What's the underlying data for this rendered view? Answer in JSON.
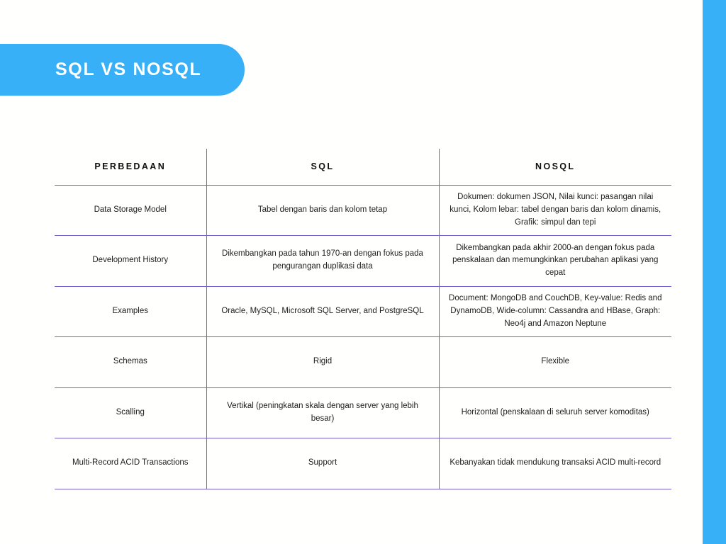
{
  "slide": {
    "title": "SQL VS NOSQL",
    "background_color": "#fffffd",
    "accent_color": "#38b0f7",
    "table_line_color": "#6f62cf"
  },
  "table": {
    "headers": [
      "PERBEDAAN",
      "SQL",
      "NOSQL"
    ],
    "rows": [
      {
        "label": "Data Storage Model",
        "sql": "Tabel dengan baris dan kolom tetap",
        "nosql": "Dokumen: dokumen JSON, Nilai kunci: pasangan nilai kunci, Kolom lebar: tabel dengan baris dan kolom dinamis, Grafik: simpul dan tepi"
      },
      {
        "label": "Development History",
        "sql": "Dikembangkan pada tahun 1970-an dengan fokus pada pengurangan duplikasi data",
        "nosql": "Dikembangkan pada akhir 2000-an dengan fokus pada penskalaan dan memungkinkan perubahan aplikasi yang cepat"
      },
      {
        "label": "Examples",
        "sql": "Oracle, MySQL, Microsoft SQL Server, and PostgreSQL",
        "nosql": "Document: MongoDB and CouchDB, Key-value: Redis and DynamoDB, Wide-column: Cassandra and HBase, Graph: Neo4j and Amazon Neptune"
      },
      {
        "label": "Schemas",
        "sql": "Rigid",
        "nosql": "Flexible"
      },
      {
        "label": "Scalling",
        "sql": "Vertikal (peningkatan skala dengan server yang lebih besar)",
        "nosql": "Horizontal (penskalaan di seluruh server komoditas)"
      },
      {
        "label": "Multi-Record ACID Transactions",
        "sql": "Support",
        "nosql": "Kebanyakan tidak mendukung transaksi ACID multi-record"
      }
    ]
  }
}
